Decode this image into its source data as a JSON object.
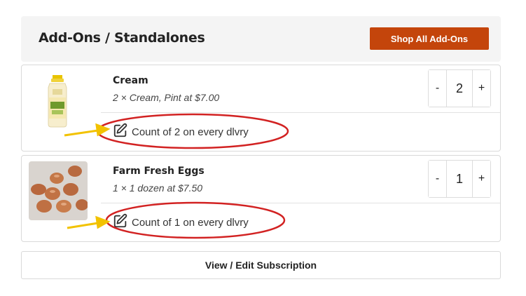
{
  "header": {
    "title": "Add-Ons / Standalones",
    "shop_button": "Shop All Add-Ons"
  },
  "items": [
    {
      "name": "Cream",
      "detail": "2 × Cream, Pint at $7.00",
      "quantity": "2",
      "minus": "-",
      "plus": "+",
      "count_text": "Count of 2 on every dlvry",
      "edit_icon": "edit-icon",
      "image": "cream-bottle"
    },
    {
      "name": "Farm Fresh Eggs",
      "detail": "1 × 1 dozen at $7.50",
      "quantity": "1",
      "minus": "-",
      "plus": "+",
      "count_text": "Count of 1 on every dlvry",
      "edit_icon": "edit-icon",
      "image": "brown-eggs"
    }
  ],
  "footer": {
    "view_edit": "View / Edit Subscription"
  },
  "colors": {
    "accent": "#c4450b",
    "annotation_ellipse": "#d22222",
    "annotation_arrow": "#f2c200"
  }
}
